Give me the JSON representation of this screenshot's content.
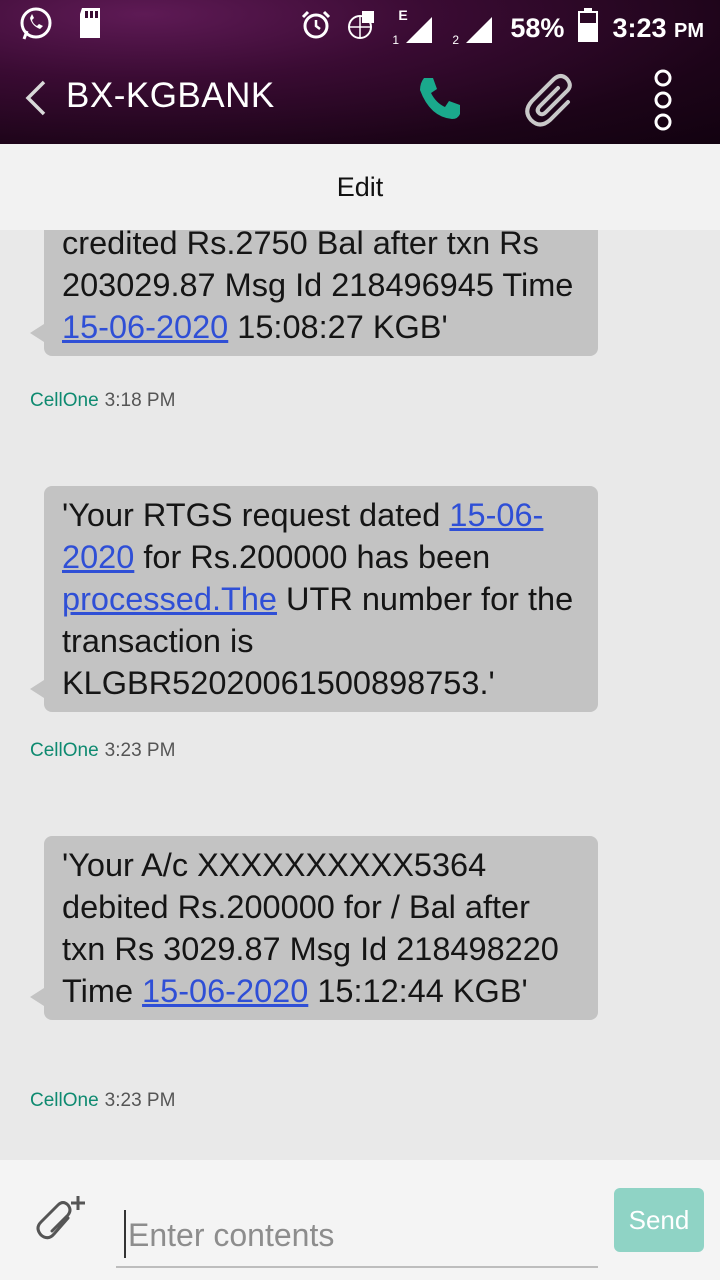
{
  "status_bar": {
    "battery": "58%",
    "time": "3:23",
    "ampm": "PM",
    "sim1_label": "1",
    "sim2_label": "2",
    "network_type": "E"
  },
  "app_bar": {
    "title": "BX-KGBANK",
    "icons": [
      "back-arrow-icon",
      "phone-icon",
      "paperclip-icon",
      "overflow-menu-icon"
    ],
    "accent_color": "#1aa98c"
  },
  "edit_label": "Edit",
  "messages": [
    {
      "text_parts": [
        "credited Rs.2750 Bal after txn Rs 203029.87 Msg Id 218496945 Time ",
        "15-06-2020",
        " 15:08:27 KGB'"
      ],
      "sender": "CellOne",
      "time": "3:18 PM"
    },
    {
      "text_parts": [
        "'Your RTGS request dated ",
        "15-06-2020",
        " for Rs.200000 has been ",
        "processed.The",
        " UTR number for the transaction is KLGBR52020061500898753.'"
      ],
      "sender": "CellOne",
      "time": "3:23 PM"
    },
    {
      "text_parts": [
        "'Your A/c XXXXXXXXXX5364 debited Rs.200000 for / Bal after txn Rs 3029.87 Msg Id 218498220 Time ",
        "15-06-2020",
        " 15:12:44 KGB'"
      ],
      "sender": "CellOne",
      "time": "3:23 PM"
    }
  ],
  "composer": {
    "placeholder": "Enter contents",
    "value": "",
    "send_label": "Send"
  }
}
